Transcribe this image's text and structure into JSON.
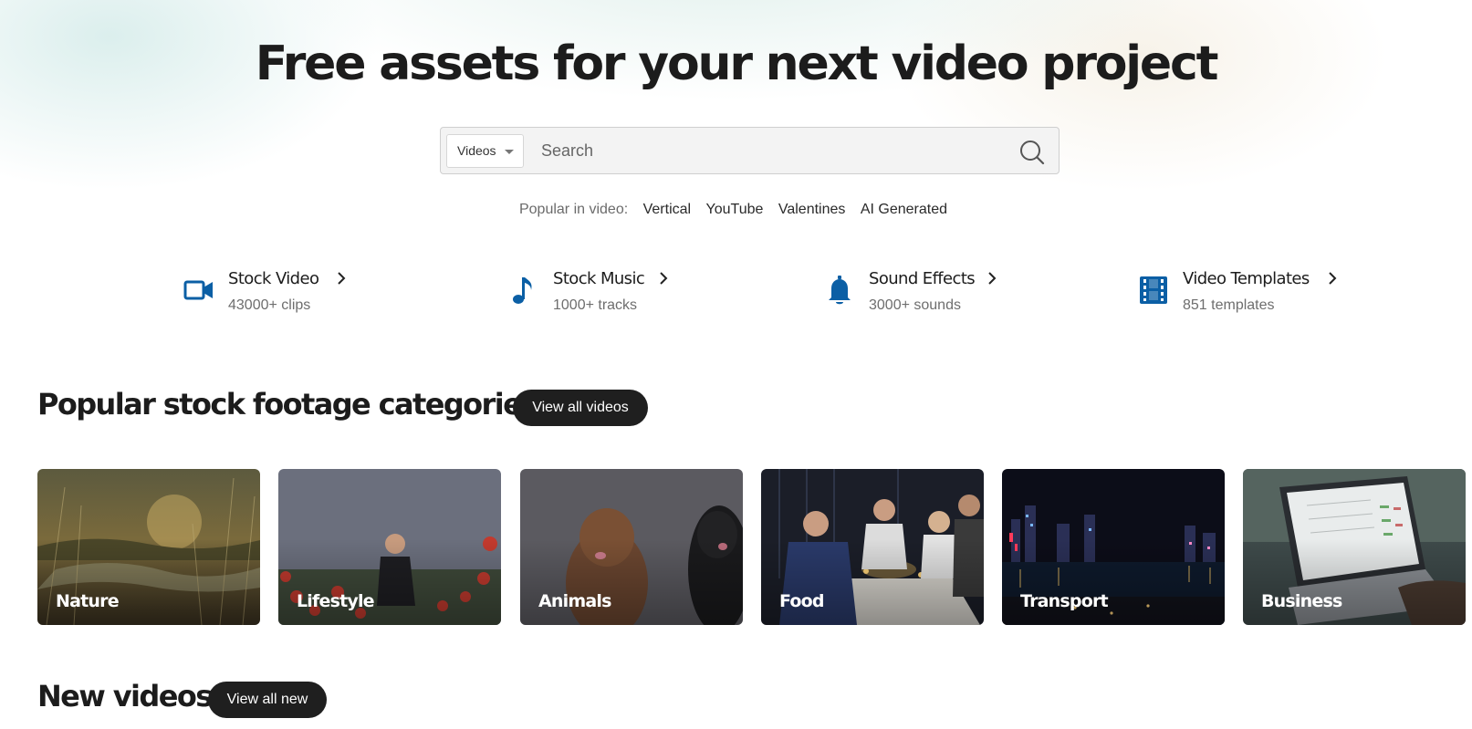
{
  "hero": {
    "title": "Free assets for your next video project"
  },
  "search": {
    "type_selected": "Videos",
    "placeholder": "Search",
    "value": ""
  },
  "popular": {
    "label": "Popular in video:",
    "tags": [
      "Vertical",
      "YouTube",
      "Valentines",
      "AI Generated"
    ]
  },
  "asset_categories": [
    {
      "name": "Stock Video",
      "count": "43000+ clips",
      "icon": "video-camera-icon"
    },
    {
      "name": "Stock Music",
      "count": "1000+ tracks",
      "icon": "music-note-icon"
    },
    {
      "name": "Sound Effects",
      "count": "3000+ sounds",
      "icon": "bell-icon"
    },
    {
      "name": "Video Templates",
      "count": "851 templates",
      "icon": "film-strip-icon"
    }
  ],
  "categories_section": {
    "title": "Popular stock footage categories",
    "button": "View all videos",
    "items": [
      {
        "label": "Nature"
      },
      {
        "label": "Lifestyle"
      },
      {
        "label": "Animals"
      },
      {
        "label": "Food"
      },
      {
        "label": "Transport"
      },
      {
        "label": "Business"
      }
    ]
  },
  "new_section": {
    "title": "New videos",
    "button": "View all new"
  },
  "colors": {
    "accent_icon": "#0b5fa5",
    "button_bg": "#1f1f1f",
    "text_primary": "#1c1c1c"
  }
}
